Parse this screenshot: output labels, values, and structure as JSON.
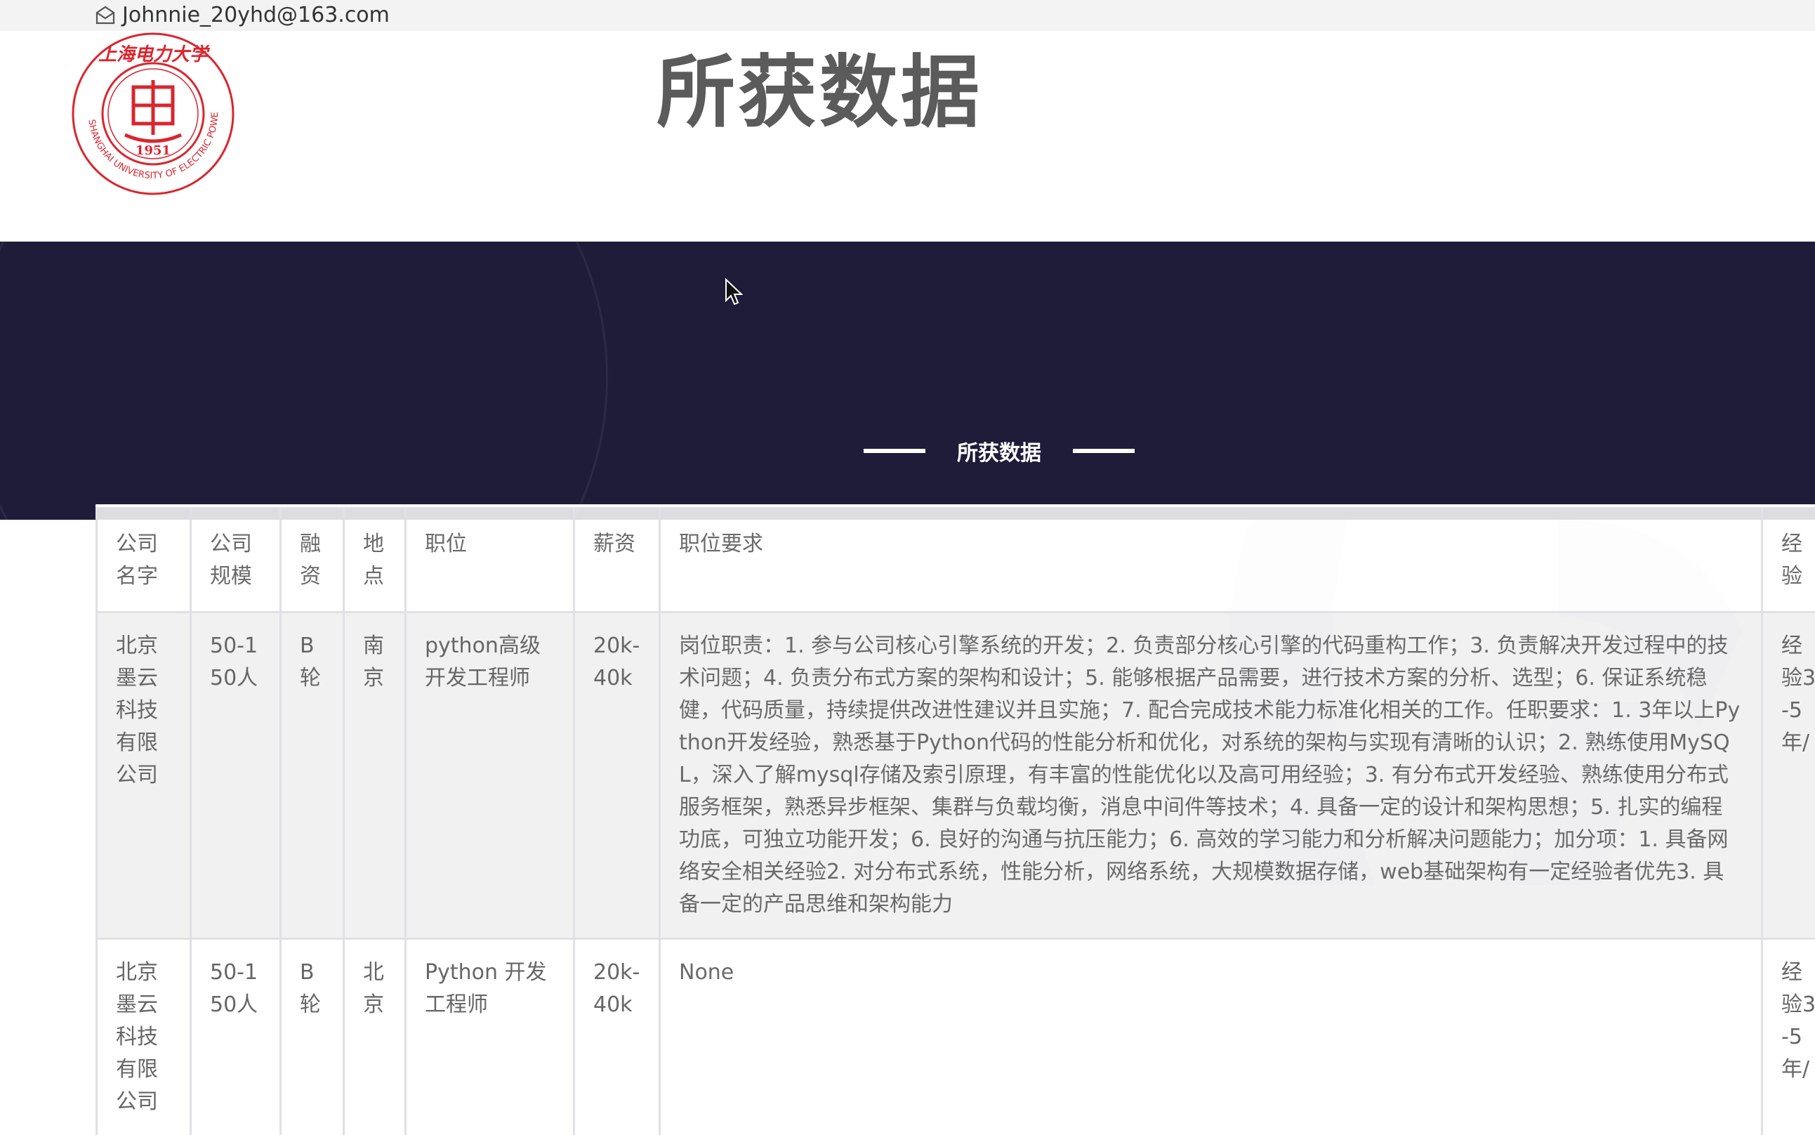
{
  "header": {
    "email": "Johnnie_20yhd@163.com",
    "page_title": "所获数据"
  },
  "logo": {
    "top_text": "上海电力大学",
    "year": "1951",
    "ring_text": "SHANGHAI UNIVERSITY OF ELECTRIC POWER",
    "color": "#d9262f"
  },
  "banner": {
    "section_title": "所获数据",
    "background": "#1e1c39"
  },
  "table": {
    "headers": [
      "公司名字",
      "公司规模",
      "融资",
      "地点",
      "职位",
      "薪资",
      "职位要求",
      "经验"
    ],
    "rows": [
      {
        "company": "北京墨云科技有限公司",
        "scale": "50-150人",
        "funding": "B轮",
        "location": "南京",
        "position": "python高级开发工程师",
        "salary": "20k-40k",
        "requirements": "岗位职责：1. 参与公司核心引擎系统的开发；2. 负责部分核心引擎的代码重构工作；3. 负责解决开发过程中的技术问题；4. 负责分布式方案的架构和设计；5. 能够根据产品需要，进行技术方案的分析、选型；6. 保证系统稳健，代码质量，持续提供改进性建议并且实施；7. 配合完成技术能力标准化相关的工作。任职要求：1. 3年以上Python开发经验，熟悉基于Python代码的性能分析和优化，对系统的架构与实现有清晰的认识；2. 熟练使用MySQL，深入了解mysql存储及索引原理，有丰富的性能优化以及高可用经验；3. 有分布式开发经验、熟练使用分布式服务框架，熟悉异步框架、集群与负载均衡，消息中间件等技术；4. 具备一定的设计和架构思想；5. 扎实的编程功底，可独立功能开发；6. 良好的沟通与抗压能力；6. 高效的学习能力和分析解决问题能力；加分项：1. 具备网络安全相关经验2. 对分布式系统，性能分析，网络系统，大规模数据存储，web基础架构有一定经验者优先3. 具备一定的产品思维和架构能力",
        "experience": "经验3-5年/"
      },
      {
        "company": "北京墨云科技有限公司",
        "scale": "50-150人",
        "funding": "B轮",
        "location": "北京",
        "position": "Python 开发工程师",
        "salary": "20k-40k",
        "requirements": "None",
        "experience": "经验3-5年/"
      }
    ]
  }
}
